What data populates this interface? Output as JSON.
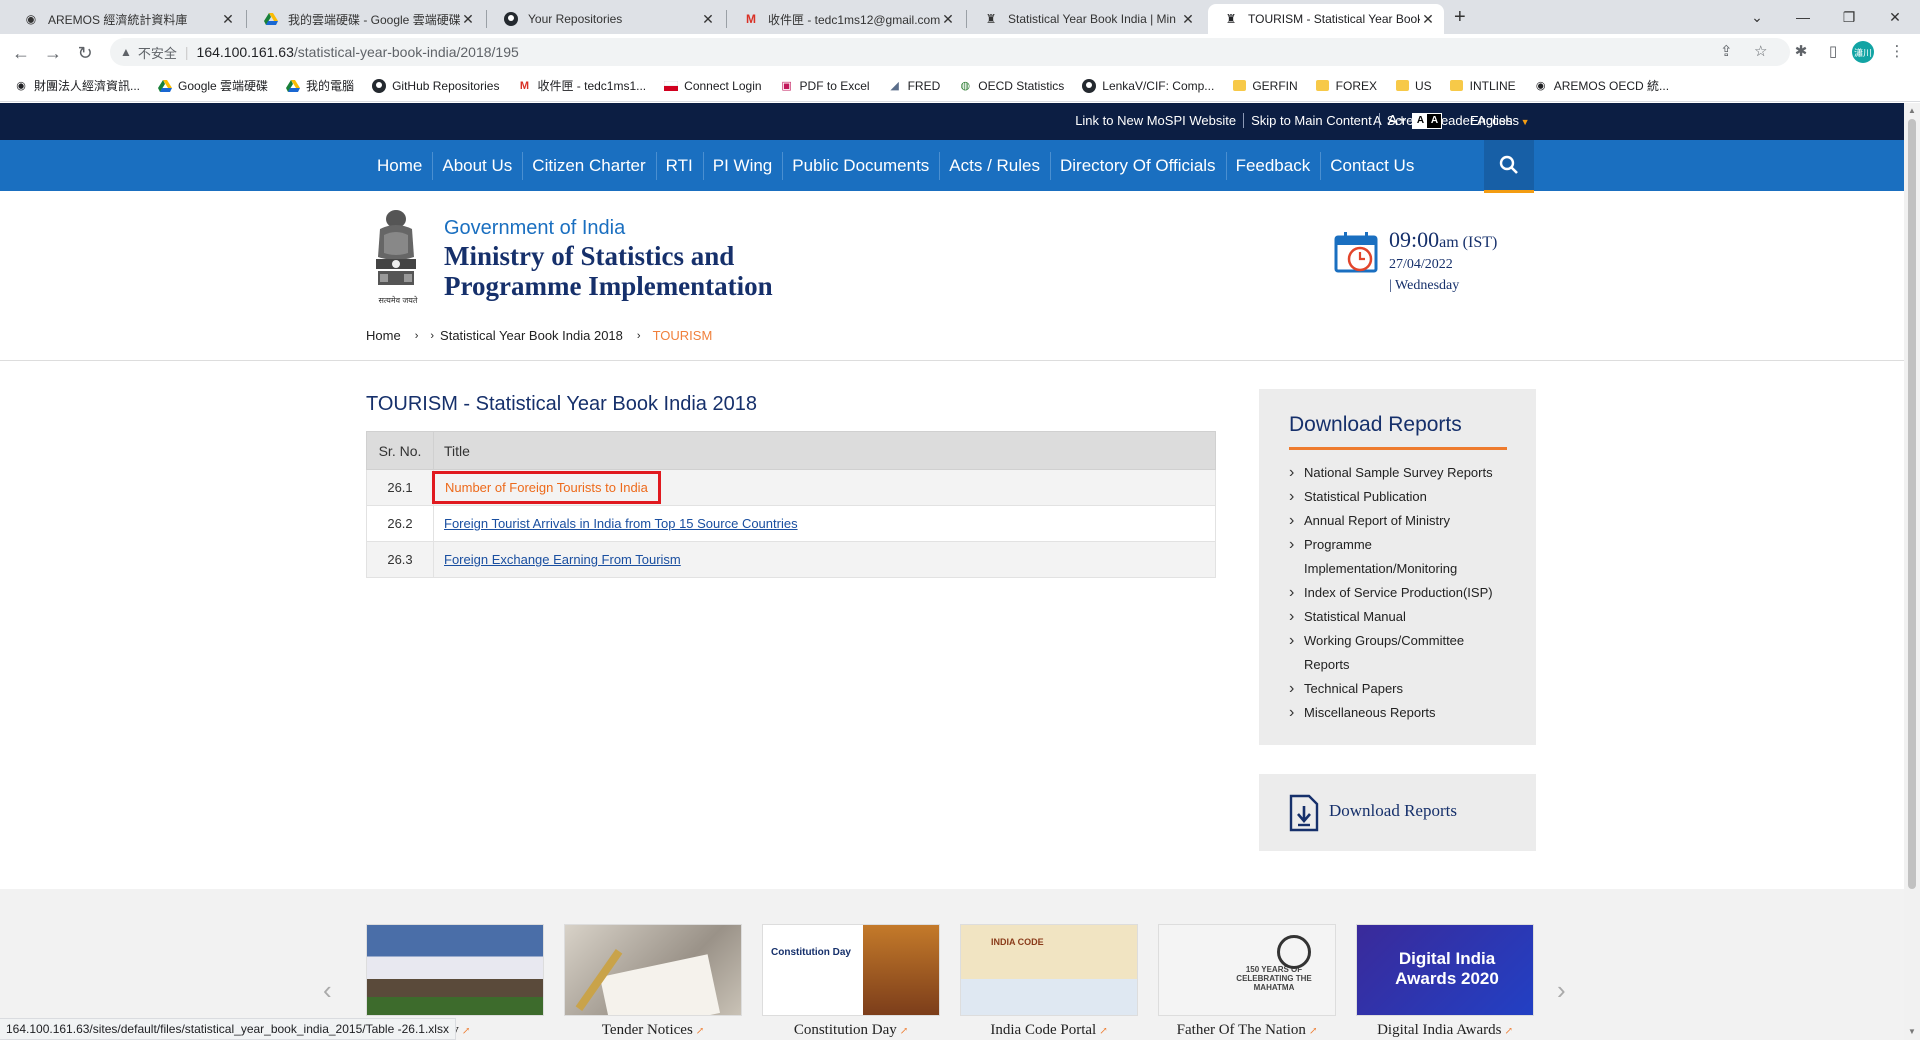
{
  "browser": {
    "tabs": [
      {
        "title": "AREMOS 經濟統計資料庫",
        "icon": "globe-icon"
      },
      {
        "title": "我的雲端硬碟 - Google 雲端硬碟",
        "icon": "drive-icon"
      },
      {
        "title": "Your Repositories",
        "icon": "github-icon"
      },
      {
        "title": "收件匣 - tedc1ms12@gmail.com",
        "icon": "gmail-icon"
      },
      {
        "title": "Statistical Year Book India | Min",
        "icon": "emblem-icon"
      },
      {
        "title": "TOURISM - Statistical Year Book",
        "icon": "emblem-icon"
      }
    ],
    "address": {
      "security_label": "不安全",
      "host": "164.100.161.63",
      "path": "/statistical-year-book-india/2018/195"
    },
    "profile_label": "瀟川",
    "bookmarks": [
      {
        "label": "財團法人經濟資訊...",
        "icon": "globe-icon"
      },
      {
        "label": "Google 雲端硬碟",
        "icon": "drive-icon"
      },
      {
        "label": "我的電腦",
        "icon": "drive-icon"
      },
      {
        "label": "GitHub Repositories",
        "icon": "github-icon"
      },
      {
        "label": "收件匣 - tedc1ms1...",
        "icon": "gmail-icon"
      },
      {
        "label": "Connect Login",
        "icon": "flag-icon"
      },
      {
        "label": "PDF to Excel",
        "icon": "pdf-icon"
      },
      {
        "label": "FRED",
        "icon": "chart-icon"
      },
      {
        "label": "OECD Statistics",
        "icon": "oecd-icon"
      },
      {
        "label": "LenkaV/CIF: Comp...",
        "icon": "github-icon"
      },
      {
        "label": "GERFIN",
        "icon": "folder-icon"
      },
      {
        "label": "FOREX",
        "icon": "folder-icon"
      },
      {
        "label": "US",
        "icon": "folder-icon"
      },
      {
        "label": "INTLINE",
        "icon": "folder-icon"
      },
      {
        "label": "AREMOS OECD 統...",
        "icon": "globe-icon"
      }
    ],
    "status_url": "164.100.161.63/sites/default/files/statistical_year_book_india_2015/Table -26.1.xlsx"
  },
  "topstrip": {
    "links": [
      "Link to New MoSPI Website",
      "Skip to Main Content",
      "Screen Reader Access"
    ],
    "font_small": "A",
    "font_large": "A+",
    "contrast_a": "A",
    "contrast_b": "A",
    "language": "English"
  },
  "mainnav": [
    "Home",
    "About Us",
    "Citizen Charter",
    "RTI",
    "PI Wing",
    "Public Documents",
    "Acts / Rules",
    "Directory Of Officials",
    "Feedback",
    "Contact Us"
  ],
  "header": {
    "gov": "Government of India",
    "ministry_line1": "Ministry of Statistics and",
    "ministry_line2": "Programme Implementation",
    "emblem_motto": "सत्यमेव जयते",
    "time": "09:00",
    "ampm": "am (IST)",
    "date": "27/04/2022",
    "day": "| Wednesday"
  },
  "breadcrumb": {
    "home": "Home",
    "middle": "Statistical Year Book India 2018",
    "current": "TOURISM"
  },
  "content": {
    "title": "TOURISM - Statistical Year Book India 2018",
    "columns": [
      "Sr. No.",
      "Title"
    ],
    "rows": [
      {
        "sr": "26.1",
        "title": "Number of Foreign Tourists to India"
      },
      {
        "sr": "26.2",
        "title": "Foreign Tourist Arrivals in India from Top 15 Source Countries"
      },
      {
        "sr": "26.3",
        "title": "Foreign Exchange Earning From Tourism"
      }
    ]
  },
  "sidebar": {
    "heading": "Download Reports",
    "items": [
      "National Sample Survey Reports",
      "Statistical Publication",
      "Annual Report of Ministry",
      "Programme Implementation/Monitoring",
      "Index of Service Production(ISP)",
      "Statistical Manual",
      "Working Groups/Committee Reports",
      "Technical Papers",
      "Miscellaneous Reports"
    ],
    "download_box": "Download Reports"
  },
  "carousel": [
    {
      "caption": "ery",
      "image_text": ""
    },
    {
      "caption": "Tender Notices",
      "image_text": ""
    },
    {
      "caption": "Constitution Day",
      "image_text": "Constitution Day"
    },
    {
      "caption": "India Code Portal",
      "image_text": "INDIA CODE"
    },
    {
      "caption": "Father Of The Nation",
      "image_text": "150 YEARS OF CELEBRATING THE MAHATMA"
    },
    {
      "caption": "Digital India Awards",
      "image_text": "Digital India Awards 2020"
    }
  ],
  "colors": {
    "topstrip": "#0c1e43",
    "nav": "#1a6fc0",
    "accent_orange": "#ee7b2e",
    "title_navy": "#16306b",
    "highlight_red": "#e0191f"
  }
}
